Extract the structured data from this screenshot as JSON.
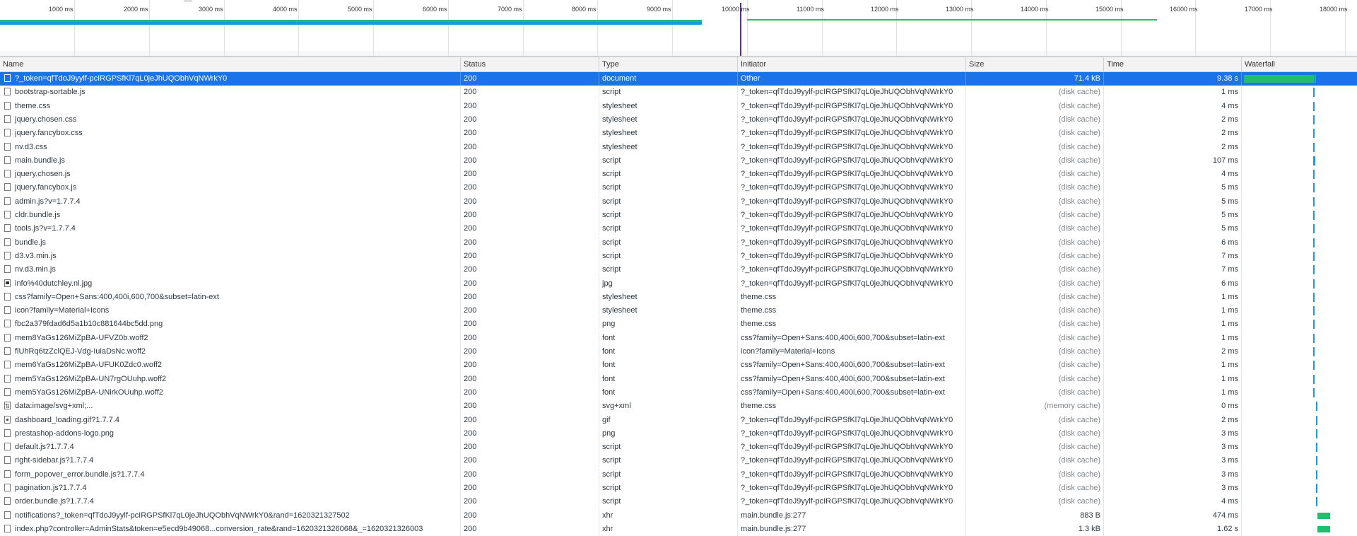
{
  "overview": {
    "ticks": [
      "1000 ms",
      "2000 ms",
      "3000 ms",
      "4000 ms",
      "5000 ms",
      "6000 ms",
      "7000 ms",
      "8000 ms",
      "9000 ms",
      "10000 ms",
      "11000 ms",
      "12000 ms",
      "13000 ms",
      "14000 ms",
      "15000 ms",
      "16000 ms",
      "17000 ms",
      "18000 ms"
    ],
    "colors": {
      "blue": "#1a9bd9",
      "green": "#1fbf6f",
      "marker": "#5b2d91"
    }
  },
  "columns": [
    "Name",
    "Status",
    "Type",
    "Initiator",
    "Size",
    "Time",
    "Waterfall"
  ],
  "rows": [
    {
      "name": "?_token=qfTdoJ9yylf-pcIRGPSfKl7qL0jeJhUQObhVqNWrkY0",
      "status": "200",
      "type": "document",
      "initiator": "Other",
      "size": "71.4 kB",
      "time": "9.38 s",
      "icon": "doc"
    },
    {
      "name": "bootstrap-sortable.js",
      "status": "200",
      "type": "script",
      "initiator": "?_token=qfTdoJ9yylf-pcIRGPSfKl7qL0jeJhUQObhVqNWrkY0",
      "size": "(disk cache)",
      "time": "1 ms",
      "icon": "doc"
    },
    {
      "name": "theme.css",
      "status": "200",
      "type": "stylesheet",
      "initiator": "?_token=qfTdoJ9yylf-pcIRGPSfKl7qL0jeJhUQObhVqNWrkY0",
      "size": "(disk cache)",
      "time": "4 ms",
      "icon": "doc"
    },
    {
      "name": "jquery.chosen.css",
      "status": "200",
      "type": "stylesheet",
      "initiator": "?_token=qfTdoJ9yylf-pcIRGPSfKl7qL0jeJhUQObhVqNWrkY0",
      "size": "(disk cache)",
      "time": "2 ms",
      "icon": "doc"
    },
    {
      "name": "jquery.fancybox.css",
      "status": "200",
      "type": "stylesheet",
      "initiator": "?_token=qfTdoJ9yylf-pcIRGPSfKl7qL0jeJhUQObhVqNWrkY0",
      "size": "(disk cache)",
      "time": "2 ms",
      "icon": "doc"
    },
    {
      "name": "nv.d3.css",
      "status": "200",
      "type": "stylesheet",
      "initiator": "?_token=qfTdoJ9yylf-pcIRGPSfKl7qL0jeJhUQObhVqNWrkY0",
      "size": "(disk cache)",
      "time": "2 ms",
      "icon": "doc"
    },
    {
      "name": "main.bundle.js",
      "status": "200",
      "type": "script",
      "initiator": "?_token=qfTdoJ9yylf-pcIRGPSfKl7qL0jeJhUQObhVqNWrkY0",
      "size": "(disk cache)",
      "time": "107 ms",
      "icon": "doc"
    },
    {
      "name": "jquery.chosen.js",
      "status": "200",
      "type": "script",
      "initiator": "?_token=qfTdoJ9yylf-pcIRGPSfKl7qL0jeJhUQObhVqNWrkY0",
      "size": "(disk cache)",
      "time": "4 ms",
      "icon": "doc"
    },
    {
      "name": "jquery.fancybox.js",
      "status": "200",
      "type": "script",
      "initiator": "?_token=qfTdoJ9yylf-pcIRGPSfKl7qL0jeJhUQObhVqNWrkY0",
      "size": "(disk cache)",
      "time": "5 ms",
      "icon": "doc"
    },
    {
      "name": "admin.js?v=1.7.7.4",
      "status": "200",
      "type": "script",
      "initiator": "?_token=qfTdoJ9yylf-pcIRGPSfKl7qL0jeJhUQObhVqNWrkY0",
      "size": "(disk cache)",
      "time": "5 ms",
      "icon": "doc"
    },
    {
      "name": "cldr.bundle.js",
      "status": "200",
      "type": "script",
      "initiator": "?_token=qfTdoJ9yylf-pcIRGPSfKl7qL0jeJhUQObhVqNWrkY0",
      "size": "(disk cache)",
      "time": "5 ms",
      "icon": "doc"
    },
    {
      "name": "tools.js?v=1.7.7.4",
      "status": "200",
      "type": "script",
      "initiator": "?_token=qfTdoJ9yylf-pcIRGPSfKl7qL0jeJhUQObhVqNWrkY0",
      "size": "(disk cache)",
      "time": "5 ms",
      "icon": "doc"
    },
    {
      "name": "bundle.js",
      "status": "200",
      "type": "script",
      "initiator": "?_token=qfTdoJ9yylf-pcIRGPSfKl7qL0jeJhUQObhVqNWrkY0",
      "size": "(disk cache)",
      "time": "6 ms",
      "icon": "doc"
    },
    {
      "name": "d3.v3.min.js",
      "status": "200",
      "type": "script",
      "initiator": "?_token=qfTdoJ9yylf-pcIRGPSfKl7qL0jeJhUQObhVqNWrkY0",
      "size": "(disk cache)",
      "time": "7 ms",
      "icon": "doc"
    },
    {
      "name": "nv.d3.min.js",
      "status": "200",
      "type": "script",
      "initiator": "?_token=qfTdoJ9yylf-pcIRGPSfKl7qL0jeJhUQObhVqNWrkY0",
      "size": "(disk cache)",
      "time": "7 ms",
      "icon": "doc"
    },
    {
      "name": "info%40dutchley.nl.jpg",
      "status": "200",
      "type": "jpg",
      "initiator": "?_token=qfTdoJ9yylf-pcIRGPSfKl7qL0jeJhUQObhVqNWrkY0",
      "size": "(disk cache)",
      "time": "6 ms",
      "icon": "img"
    },
    {
      "name": "css?family=Open+Sans:400,400i,600,700&subset=latin-ext",
      "status": "200",
      "type": "stylesheet",
      "initiator": "theme.css",
      "size": "(disk cache)",
      "time": "1 ms",
      "icon": "doc"
    },
    {
      "name": "icon?family=Material+Icons",
      "status": "200",
      "type": "stylesheet",
      "initiator": "theme.css",
      "size": "(disk cache)",
      "time": "1 ms",
      "icon": "doc"
    },
    {
      "name": "fbc2a379fdad6d5a1b10c881644bc5dd.png",
      "status": "200",
      "type": "png",
      "initiator": "theme.css",
      "size": "(disk cache)",
      "time": "1 ms",
      "icon": "doc"
    },
    {
      "name": "mem8YaGs126MiZpBA-UFVZ0b.woff2",
      "status": "200",
      "type": "font",
      "initiator": "css?family=Open+Sans:400,400i,600,700&subset=latin-ext",
      "size": "(disk cache)",
      "time": "1 ms",
      "icon": "doc"
    },
    {
      "name": "flUhRq6tzZclQEJ-Vdg-IuiaDsNc.woff2",
      "status": "200",
      "type": "font",
      "initiator": "icon?family=Material+Icons",
      "size": "(disk cache)",
      "time": "2 ms",
      "icon": "doc"
    },
    {
      "name": "mem6YaGs126MiZpBA-UFUK0Zdc0.woff2",
      "status": "200",
      "type": "font",
      "initiator": "css?family=Open+Sans:400,400i,600,700&subset=latin-ext",
      "size": "(disk cache)",
      "time": "1 ms",
      "icon": "doc"
    },
    {
      "name": "mem5YaGs126MiZpBA-UN7rgOUuhp.woff2",
      "status": "200",
      "type": "font",
      "initiator": "css?family=Open+Sans:400,400i,600,700&subset=latin-ext",
      "size": "(disk cache)",
      "time": "1 ms",
      "icon": "doc"
    },
    {
      "name": "mem5YaGs126MiZpBA-UNirkOUuhp.woff2",
      "status": "200",
      "type": "font",
      "initiator": "css?family=Open+Sans:400,400i,600,700&subset=latin-ext",
      "size": "(disk cache)",
      "time": "1 ms",
      "icon": "doc"
    },
    {
      "name": "data:image/svg+xml;...",
      "status": "200",
      "type": "svg+xml",
      "initiator": "theme.css",
      "size": "(memory cache)",
      "time": "0 ms",
      "icon": "svg"
    },
    {
      "name": "dashboard_loading.gif?1.7.7.4",
      "status": "200",
      "type": "gif",
      "initiator": "?_token=qfTdoJ9yylf-pcIRGPSfKl7qL0jeJhUQObhVqNWrkY0",
      "size": "(disk cache)",
      "time": "2 ms",
      "icon": "gif"
    },
    {
      "name": "prestashop-addons-logo.png",
      "status": "200",
      "type": "png",
      "initiator": "?_token=qfTdoJ9yylf-pcIRGPSfKl7qL0jeJhUQObhVqNWrkY0",
      "size": "(disk cache)",
      "time": "3 ms",
      "icon": "doc"
    },
    {
      "name": "default.js?1.7.7.4",
      "status": "200",
      "type": "script",
      "initiator": "?_token=qfTdoJ9yylf-pcIRGPSfKl7qL0jeJhUQObhVqNWrkY0",
      "size": "(disk cache)",
      "time": "3 ms",
      "icon": "doc"
    },
    {
      "name": "right-sidebar.js?1.7.7.4",
      "status": "200",
      "type": "script",
      "initiator": "?_token=qfTdoJ9yylf-pcIRGPSfKl7qL0jeJhUQObhVqNWrkY0",
      "size": "(disk cache)",
      "time": "3 ms",
      "icon": "doc"
    },
    {
      "name": "form_popover_error.bundle.js?1.7.7.4",
      "status": "200",
      "type": "script",
      "initiator": "?_token=qfTdoJ9yylf-pcIRGPSfKl7qL0jeJhUQObhVqNWrkY0",
      "size": "(disk cache)",
      "time": "3 ms",
      "icon": "doc"
    },
    {
      "name": "pagination.js?1.7.7.4",
      "status": "200",
      "type": "script",
      "initiator": "?_token=qfTdoJ9yylf-pcIRGPSfKl7qL0jeJhUQObhVqNWrkY0",
      "size": "(disk cache)",
      "time": "3 ms",
      "icon": "doc"
    },
    {
      "name": "order.bundle.js?1.7.7.4",
      "status": "200",
      "type": "script",
      "initiator": "?_token=qfTdoJ9yylf-pcIRGPSfKl7qL0jeJhUQObhVqNWrkY0",
      "size": "(disk cache)",
      "time": "4 ms",
      "icon": "doc"
    },
    {
      "name": "notifications?_token=qfTdoJ9yylf-pcIRGPSfKl7qL0jeJhUQObhVqNWrkY0&rand=1620321327502",
      "status": "200",
      "type": "xhr",
      "initiator": "main.bundle.js:277",
      "size": "883 B",
      "time": "474 ms",
      "icon": "doc"
    },
    {
      "name": "index.php?controller=AdminStats&token=e5ecd9b49068...conversion_rate&rand=1620321326068&_=1620321326003",
      "status": "200",
      "type": "xhr",
      "initiator": "main.bundle.js:277",
      "size": "1.3 kB",
      "time": "1.62 s",
      "icon": "doc"
    }
  ]
}
